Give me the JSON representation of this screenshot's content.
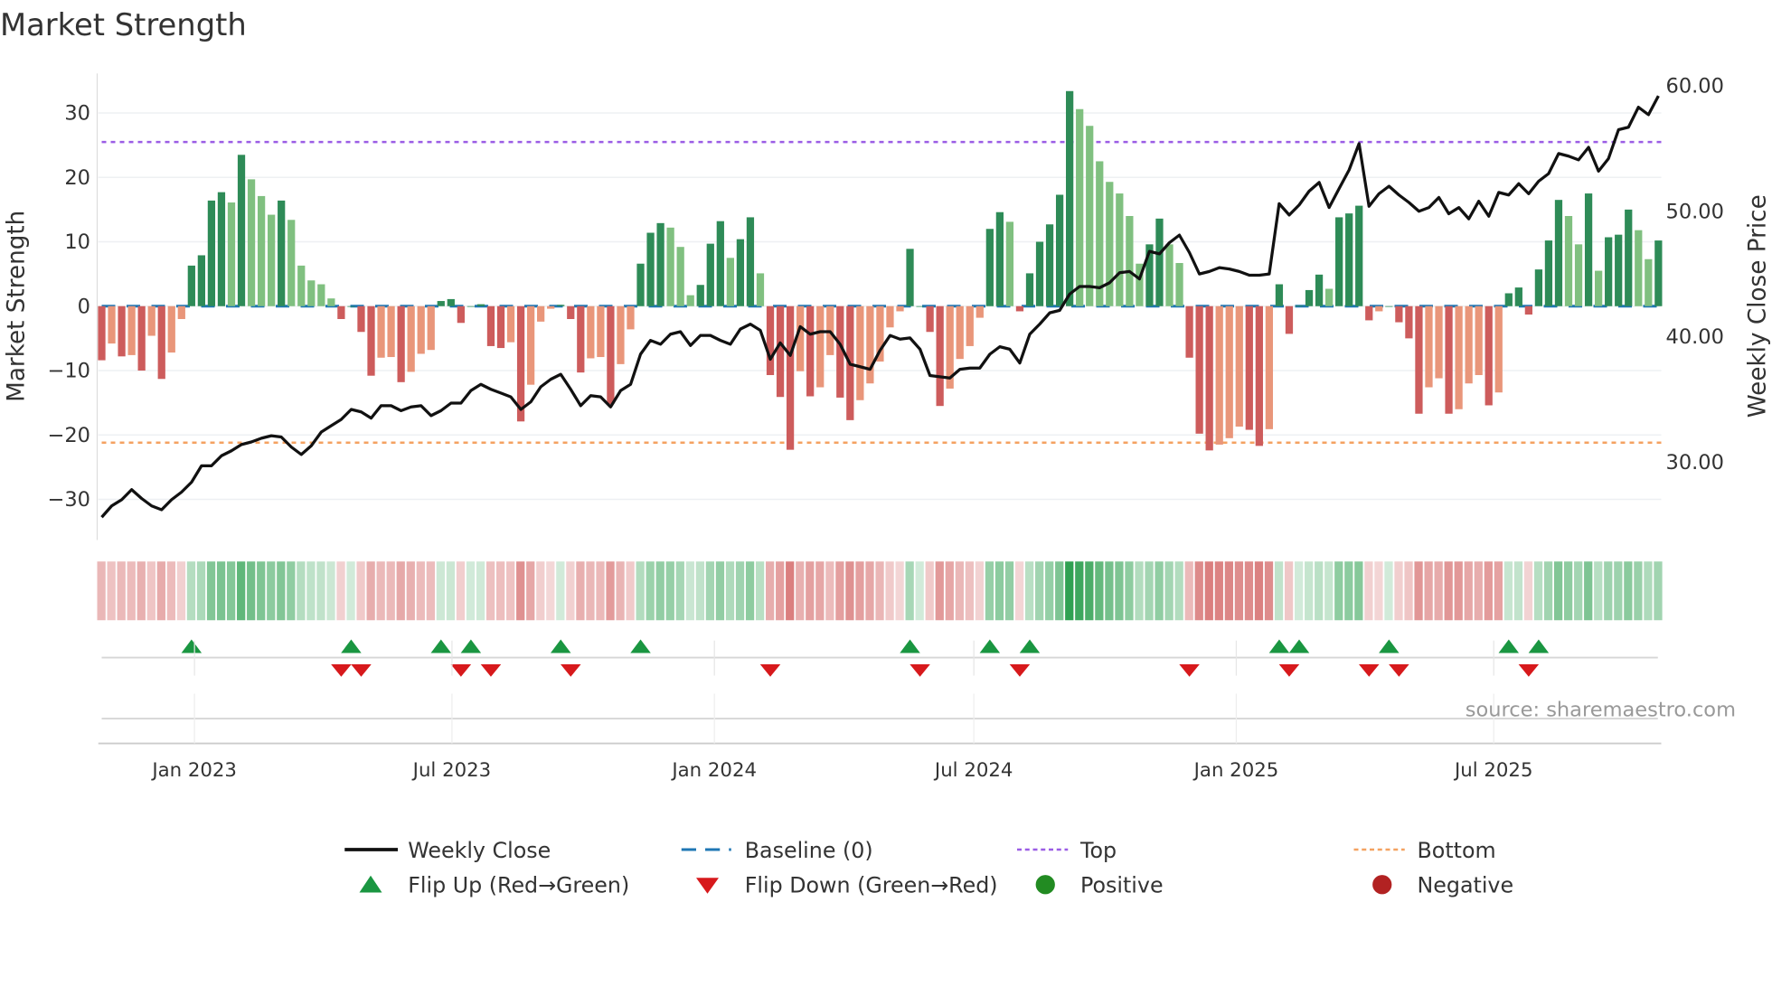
{
  "chart_data": {
    "type": "bar",
    "title": "Market Strength",
    "ylabel": "Market Strength",
    "y2label": "Weekly Close Price",
    "ylim": [
      -36,
      36
    ],
    "y2lim": [
      23.4,
      61.1
    ],
    "y_ticks": [
      "−30",
      "−20",
      "−10",
      "0",
      "10",
      "20",
      "30"
    ],
    "y_tick_values": [
      -30,
      -20,
      -10,
      0,
      10,
      20,
      30
    ],
    "y2_ticks": [
      "30.00",
      "40.00",
      "50.00",
      "60.00"
    ],
    "y2_tick_values": [
      30,
      40,
      50,
      60
    ],
    "x_ticks": [
      {
        "label": "Jan 2023",
        "week": 9.3
      },
      {
        "label": "Jul 2023",
        "week": 35.1
      },
      {
        "label": "Jan 2024",
        "week": 61.4
      },
      {
        "label": "Jul 2024",
        "week": 87.4
      },
      {
        "label": "Jan 2025",
        "week": 113.7
      },
      {
        "label": "Jul 2025",
        "week": 139.5
      }
    ],
    "top_level": 25.5,
    "bottom_level": -21.2,
    "baseline": 0,
    "strength": [
      -8.4,
      -5.8,
      -7.8,
      -7.6,
      -10,
      -4.6,
      -11.3,
      -7.2,
      -2,
      6.3,
      7.9,
      16.4,
      17.7,
      16.1,
      23.5,
      19.7,
      17.1,
      14.2,
      16.4,
      13.4,
      6.3,
      4,
      3.4,
      1.2,
      -2,
      0,
      -4,
      -10.8,
      -8,
      -7.9,
      -11.8,
      -10.2,
      -7.4,
      -6.8,
      0.8,
      1.1,
      -2.6,
      0,
      0.3,
      -6.2,
      -6.5,
      -5.6,
      -17.9,
      -12.2,
      -2.4,
      -0.4,
      0.2,
      -2,
      -10.3,
      -8.1,
      -7.9,
      -15.2,
      -9,
      -3.6,
      6.6,
      11.4,
      12.9,
      12.2,
      9.2,
      1.7,
      3.3,
      9.7,
      13.2,
      7.5,
      10.4,
      13.8,
      5.1,
      -10.7,
      -14.1,
      -22.3,
      -10.1,
      -14,
      -12.6,
      -7.6,
      -14.2,
      -17.7,
      -14.6,
      -12,
      -8.6,
      -3.3,
      -0.8,
      8.9,
      0,
      -4,
      -15.5,
      -12.8,
      -8.2,
      -6.2,
      -1.8,
      12,
      14.6,
      13.1,
      -0.8,
      5.1,
      10,
      12.7,
      17.3,
      33.4,
      30.6,
      28,
      22.5,
      19.3,
      17.5,
      14,
      6.6,
      9.6,
      13.6,
      9.6,
      6.7,
      -8,
      -19.8,
      -22.4,
      -21.5,
      -20.5,
      -18.7,
      -19.2,
      -21.7,
      -19.1,
      3.4,
      -4.3,
      0.1,
      2.5,
      4.9,
      2.7,
      13.8,
      14.4,
      15.6,
      -2.2,
      -0.8,
      0,
      -2.5,
      -5,
      -16.7,
      -12.6,
      -11.2,
      -16.7,
      -16,
      -12,
      -10.7,
      -15.4,
      -13.4,
      2,
      2.9,
      -1.3,
      5.7,
      10.2,
      16.5,
      14,
      9.6,
      17.5,
      5.5,
      10.7,
      11.1,
      15,
      11.8,
      7.3,
      10.2
    ],
    "weekly_close": [
      25.6,
      26.5,
      27.0,
      27.8,
      27.1,
      26.5,
      26.2,
      27.0,
      27.6,
      28.4,
      29.7,
      29.7,
      30.5,
      30.9,
      31.4,
      31.6,
      31.9,
      32.1,
      32.0,
      31.2,
      30.6,
      31.3,
      32.4,
      32.9,
      33.4,
      34.2,
      34.0,
      33.5,
      34.5,
      34.5,
      34.1,
      34.4,
      34.5,
      33.7,
      34.1,
      34.7,
      34.7,
      35.7,
      36.2,
      35.8,
      35.5,
      35.2,
      34.2,
      34.8,
      36.0,
      36.6,
      37.0,
      35.8,
      34.5,
      35.3,
      35.2,
      34.4,
      35.7,
      36.2,
      38.6,
      39.7,
      39.4,
      40.2,
      40.4,
      39.3,
      40.1,
      40.1,
      39.7,
      39.4,
      40.6,
      41.0,
      40.5,
      38.2,
      39.5,
      38.5,
      40.8,
      40.2,
      40.4,
      40.4,
      39.4,
      37.8,
      37.6,
      37.4,
      38.9,
      40.1,
      39.8,
      39.9,
      39.0,
      36.9,
      36.8,
      36.7,
      37.4,
      37.5,
      37.5,
      38.6,
      39.2,
      39.0,
      37.9,
      40.2,
      41.0,
      41.9,
      42.1,
      43.4,
      44.0,
      44.0,
      43.9,
      44.3,
      45.1,
      45.2,
      44.6,
      46.8,
      46.6,
      47.5,
      48.1,
      46.7,
      45.0,
      45.2,
      45.5,
      45.4,
      45.2,
      44.9,
      44.9,
      45.0,
      50.6,
      49.7,
      50.5,
      51.6,
      52.3,
      50.3,
      51.8,
      53.3,
      55.4,
      50.4,
      51.4,
      52.0,
      51.3,
      50.7,
      50.0,
      50.3,
      51.1,
      49.8,
      50.3,
      49.4,
      50.8,
      49.6,
      51.5,
      51.3,
      52.2,
      51.4,
      52.4,
      53.0,
      54.6,
      54.4,
      54.1,
      55.1,
      53.2,
      54.2,
      56.5,
      56.7,
      58.3,
      57.7,
      59.2
    ],
    "flip_up_weeks": [
      9,
      25,
      34,
      37,
      46,
      54,
      81,
      89,
      93,
      118,
      120,
      129,
      141,
      144
    ],
    "flip_down_weeks": [
      24,
      26,
      36,
      39,
      47,
      67,
      82,
      92,
      109,
      119,
      127,
      130,
      143
    ],
    "legend": [
      {
        "label": "Weekly Close",
        "symbol": "line",
        "color": "#111111"
      },
      {
        "label": "Baseline (0)",
        "symbol": "dash",
        "color": "#1f77b4"
      },
      {
        "label": "Top",
        "symbol": "dotted",
        "color": "#9b5de5"
      },
      {
        "label": "Bottom",
        "symbol": "dotted",
        "color": "#f4a261"
      },
      {
        "label": "Flip Up (Red→Green)",
        "symbol": "triangle-up",
        "color": "#1a9641"
      },
      {
        "label": "Flip Down (Green→Red)",
        "symbol": "triangle-down",
        "color": "#d7191c"
      },
      {
        "label": "Positive",
        "symbol": "circle",
        "color": "#228b22"
      },
      {
        "label": "Negative",
        "symbol": "circle",
        "color": "#b22222"
      }
    ],
    "legend_position": "bottom",
    "colors": {
      "pos_rising": "#2e8b57",
      "pos_falling": "#80c080",
      "neg_rising": "#cd5c5c",
      "neg_falling": "#e9967a"
    }
  },
  "source": "source: sharemaestro.com"
}
